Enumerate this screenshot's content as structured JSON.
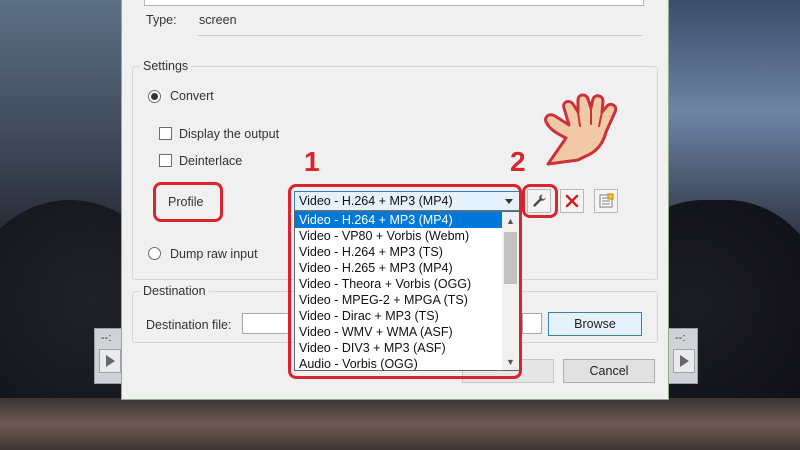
{
  "source": {
    "type_label": "Type:",
    "type_value": "screen"
  },
  "settings": {
    "title": "Settings",
    "convert_label": "Convert",
    "display_output_label": "Display the output",
    "deinterlace_label": "Deinterlace",
    "profile_button": "Profile",
    "profile_selected": "Video - H.264 + MP3 (MP4)",
    "profile_options": [
      "Video - H.264 + MP3 (MP4)",
      "Video - VP80 + Vorbis (Webm)",
      "Video - H.264 + MP3 (TS)",
      "Video - H.265 + MP3 (MP4)",
      "Video - Theora + Vorbis (OGG)",
      "Video - MPEG-2 + MPGA (TS)",
      "Video - Dirac + MP3 (TS)",
      "Video - WMV + WMA (ASF)",
      "Video - DIV3 + MP3 (ASF)",
      "Audio - Vorbis (OGG)"
    ],
    "dump_raw_label": "Dump raw input",
    "tool_icons": [
      "wrench-icon",
      "delete-icon",
      "new-profile-icon"
    ]
  },
  "destination": {
    "title": "Destination",
    "file_label": "Destination file:",
    "browse_label": "Browse"
  },
  "footer": {
    "start_label": "",
    "cancel_label": "Cancel"
  },
  "annotations": {
    "step1": "1",
    "step2": "2",
    "color": "#d9232e"
  },
  "side_controls": {
    "left_dash": "--:",
    "right_dash": "--:"
  }
}
